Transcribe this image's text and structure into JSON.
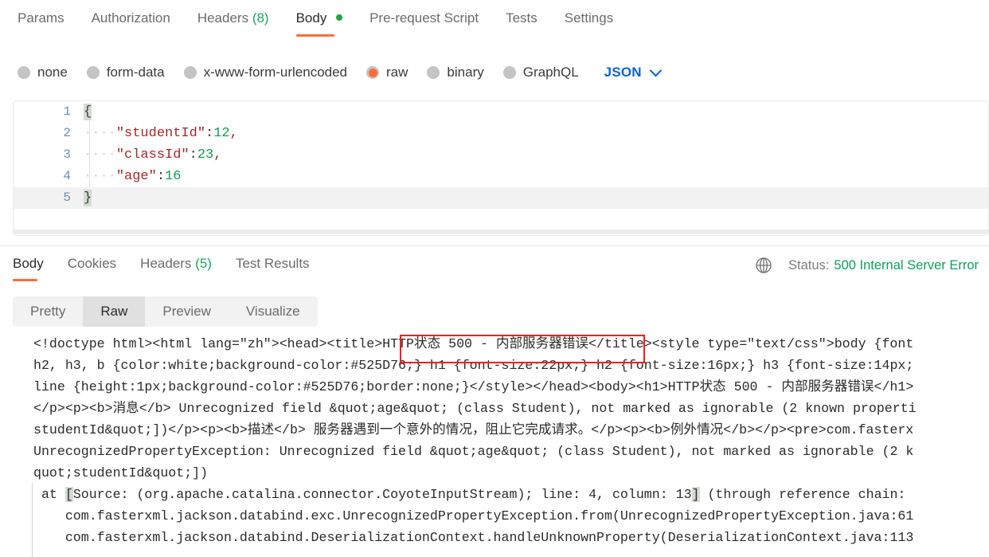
{
  "request": {
    "tabs": [
      {
        "label": "Params",
        "active": false
      },
      {
        "label": "Authorization",
        "active": false
      },
      {
        "label": "Headers",
        "count": "(8)",
        "active": false
      },
      {
        "label": "Body",
        "active": true,
        "dot": "green"
      },
      {
        "label": "Pre-request Script",
        "active": false
      },
      {
        "label": "Tests",
        "active": false
      },
      {
        "label": "Settings",
        "active": false
      }
    ],
    "body_types": [
      {
        "label": "none",
        "selected": false
      },
      {
        "label": "form-data",
        "selected": false
      },
      {
        "label": "x-www-form-urlencoded",
        "selected": false
      },
      {
        "label": "raw",
        "selected": true
      },
      {
        "label": "binary",
        "selected": false
      },
      {
        "label": "GraphQL",
        "selected": false
      }
    ],
    "format_selector": {
      "value": "JSON",
      "icon": "chevron-down-icon"
    },
    "editor": {
      "lines": [
        {
          "no": "1",
          "text": "{"
        },
        {
          "no": "2",
          "indent": "····",
          "key": "\"studentId\"",
          "colon": ":",
          "value": "12",
          "comma": ","
        },
        {
          "no": "3",
          "indent": "····",
          "key": "\"classId\"",
          "colon": ":",
          "value": "23",
          "comma": ","
        },
        {
          "no": "4",
          "indent": "····",
          "key": "\"age\"",
          "colon": ":",
          "value": "16",
          "comma": ""
        },
        {
          "no": "5",
          "text": "}"
        }
      ]
    }
  },
  "response": {
    "tabs": [
      {
        "label": "Body",
        "active": true
      },
      {
        "label": "Cookies",
        "active": false
      },
      {
        "label": "Headers",
        "count": "(5)",
        "active": false
      },
      {
        "label": "Test Results",
        "active": false
      }
    ],
    "status": {
      "icon": "globe-icon",
      "label": "Status:",
      "value": "500 Internal Server Error",
      "color": "#10a05a"
    },
    "view_modes": [
      {
        "label": "Pretty",
        "active": false
      },
      {
        "label": "Raw",
        "active": true
      },
      {
        "label": "Preview",
        "active": false
      },
      {
        "label": "Visualize",
        "active": false
      }
    ],
    "raw_lines": [
      "<!doctype html><html lang=\"zh\"><head><title>HTTP状态 500 - 内部服务器错误</title><style type=\"text/css\">body {font",
      "h2, h3, b {color:white;background-color:#525D76;} h1 {font-size:22px;} h2 {font-size:16px;} h3 {font-size:14px;",
      "line {height:1px;background-color:#525D76;border:none;}</style></head><body><h1>HTTP状态 500 - 内部服务器错误</h1>",
      "</p><p><b>消息</b> Unrecognized field &quot;age&quot; (class Student), not marked as ignorable (2 known properti",
      "studentId&quot;])</p><p><b>描述</b> 服务器遇到一个意外的情况，阻止它完成请求。</p><p><b>例外情况</b></p><pre>com.fasterx",
      "UnrecognizedPropertyException: Unrecognized field &quot;age&quot; (class Student), not marked as ignorable (2 k",
      "quot;studentId&quot;])"
    ],
    "stack_lines": [
      {
        "pre": " at ",
        "bracket": "[",
        "post": "Source: (org.apache.catalina.connector.CoyoteInputStream); line: 4, column: 13",
        "bracket2": "]",
        "tail": " (through reference chain: "
      },
      {
        "text": "    com.fasterxml.jackson.databind.exc.UnrecognizedPropertyException.from(UnrecognizedPropertyException.java:61"
      },
      {
        "text": "    com.fasterxml.jackson.databind.DeserializationContext.handleUnknownProperty(DeserializationContext.java:113"
      }
    ],
    "annotation": {
      "shape": "red-rectangle",
      "target": "HTTP状态 500 - 内部服务器错误",
      "color": "#f01f1f"
    }
  }
}
